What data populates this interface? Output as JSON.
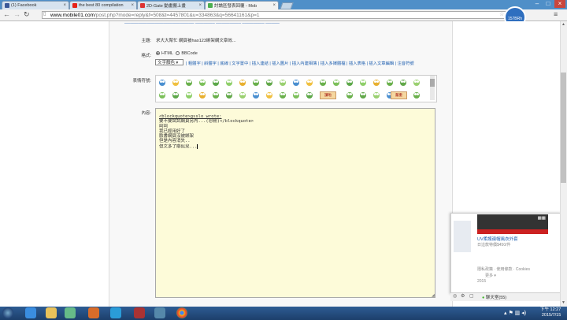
{
  "browser": {
    "tabs": [
      {
        "title": "(1) Facebook",
        "color": "#3b5998"
      },
      {
        "title": "the best 80 compilation",
        "color": "#e62117"
      },
      {
        "title": "2D-Gate 動畫搬上畫",
        "color": "#d33"
      },
      {
        "title": "討論區發表回覆 - Mob",
        "color": "#4caf50"
      }
    ],
    "url_host": "www.mobile01.com",
    "url_path": "/post.php?mode=reply&f=508&t=4457801&u=334863&q=56641161&p=1",
    "profile_label": "157BRh"
  },
  "form": {
    "subject_label": "主題:",
    "subject_value": "求大大幫忙 網頁被hao123綁架網文章效...",
    "format_label": "格式:",
    "format_html": "HTML",
    "format_bbcode": "BBCode",
    "color_select": "文字顏色",
    "toolbar_links": "| 粗體字 | 斜體字 | 底線 | 文字置中 | 插入連結 | 插入圖片 | 插入內建相簿 | 插入多媒體檔 | 插入表格 | 插入文章編輯 | 注音符號",
    "emoticon_label": "表情符號:",
    "emo_btn_1": "讚啦",
    "emo_btn_2": "嚴重",
    "content_label": "內容:",
    "editor_lines": [
      "<blockquote>gsslo wrote:",
      "要不要試試網頁另內...(恕刪)</blockquote>",
      "呵呵",
      "我已經用好了",
      "臉書網頁沒被綁架",
      "但是內容消失..",
      "但文多了啲似兒..."
    ]
  },
  "ad": {
    "headline": "UV柔護連帽風衣外套",
    "sub": "日這款特價$450/件",
    "links": "隱私政策 · 使用條款 · Cookies",
    "more": "更多 ▾",
    "year": "2015",
    "chat": "聊天室(55)"
  },
  "taskbar": {
    "time": "下午 12:27",
    "date": "2015/7/15"
  }
}
